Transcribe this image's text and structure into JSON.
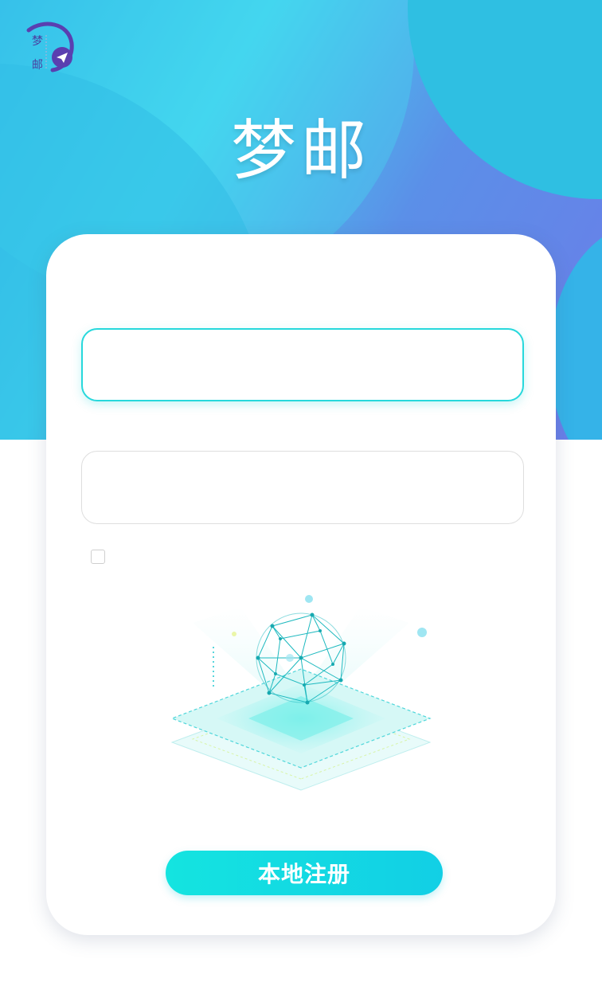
{
  "app": {
    "title": "梦邮",
    "logo_text": "梦邮"
  },
  "form": {
    "field1_value": "",
    "field1_placeholder": "",
    "field2_value": "",
    "field2_placeholder": "",
    "checkbox_checked": false
  },
  "actions": {
    "register_label": "本地注册"
  },
  "colors": {
    "accent": "#14e4e0",
    "hero_start": "#2fb2e6",
    "hero_end": "#6b7de8",
    "logo_purple": "#5a3fb0"
  },
  "icons": {
    "logo": "paper-plane-icon",
    "illustration": "network-globe-platform"
  }
}
